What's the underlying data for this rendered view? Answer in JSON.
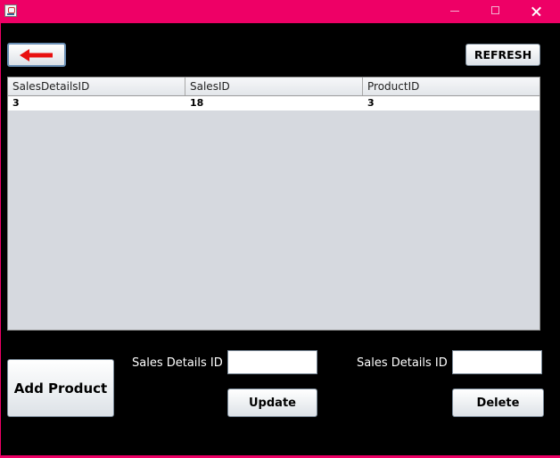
{
  "window": {
    "title": "",
    "app_icon": "java-coffee-icon",
    "controls": [
      "minimize-icon",
      "maximize-icon",
      "close-icon"
    ],
    "titlebar_color": "#ee0066"
  },
  "toolbar": {
    "back_icon": "red-left-arrow-icon",
    "refresh_label": "REFRESH"
  },
  "table": {
    "columns": [
      "SalesDetailsID",
      "SalesID",
      "ProductID"
    ],
    "rows": [
      [
        "3",
        "18",
        "3"
      ]
    ]
  },
  "form": {
    "add_product_label": "Add Product",
    "update_section": {
      "field_label": "Sales Details ID",
      "field_value": "",
      "button_label": "Update"
    },
    "delete_section": {
      "field_label": "Sales Details ID",
      "field_value": "",
      "button_label": "Delete"
    }
  },
  "colors": {
    "background": "#000000",
    "accent": "#ee0066",
    "back_arrow": "#e81010"
  }
}
